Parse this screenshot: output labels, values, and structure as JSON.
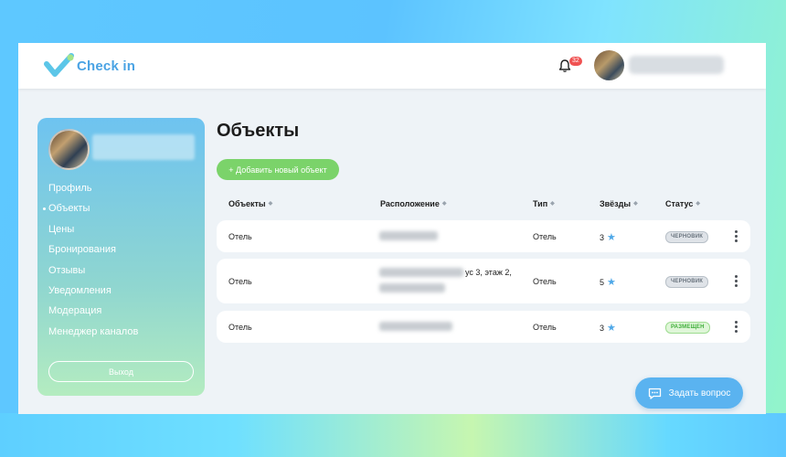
{
  "header": {
    "logo_text": "Check in",
    "notifications_count": "32"
  },
  "sidebar": {
    "items": [
      {
        "label": "Профиль"
      },
      {
        "label": "Объекты"
      },
      {
        "label": "Цены"
      },
      {
        "label": "Бронирования"
      },
      {
        "label": "Отзывы"
      },
      {
        "label": "Уведомления"
      },
      {
        "label": "Модерация"
      },
      {
        "label": "Менеджер каналов"
      }
    ],
    "active_item": "Объекты",
    "logout_label": "Выход"
  },
  "main": {
    "title": "Объекты",
    "add_button_label": "+ Добавить новый объект",
    "columns": [
      "Объекты",
      "Расположение",
      "Тип",
      "Звёзды",
      "Статус"
    ],
    "rows": [
      {
        "name": "Отель",
        "location": "",
        "type": "Отель",
        "stars": "3",
        "status": "ЧЕРНОВИК",
        "status_kind": "draft"
      },
      {
        "name": "Отель",
        "location": "ус 3, этаж 2,",
        "type": "Отель",
        "stars": "5",
        "status": "ЧЕРНОВИК",
        "status_kind": "draft"
      },
      {
        "name": "Отель",
        "location": "",
        "type": "Отель",
        "stars": "3",
        "status": "РАЗМЕЩЕН",
        "status_kind": "published"
      }
    ]
  },
  "ask_button_label": "Задать вопрос",
  "colors": {
    "accent_blue": "#4aa3e4",
    "add_green": "#7bd36a",
    "badge_red": "#f05252",
    "star_blue": "#4fa8e8"
  },
  "icons": [
    "logo-check-icon",
    "bell-icon",
    "sort-icon",
    "star-icon",
    "more-vertical-icon",
    "chat-icon"
  ]
}
